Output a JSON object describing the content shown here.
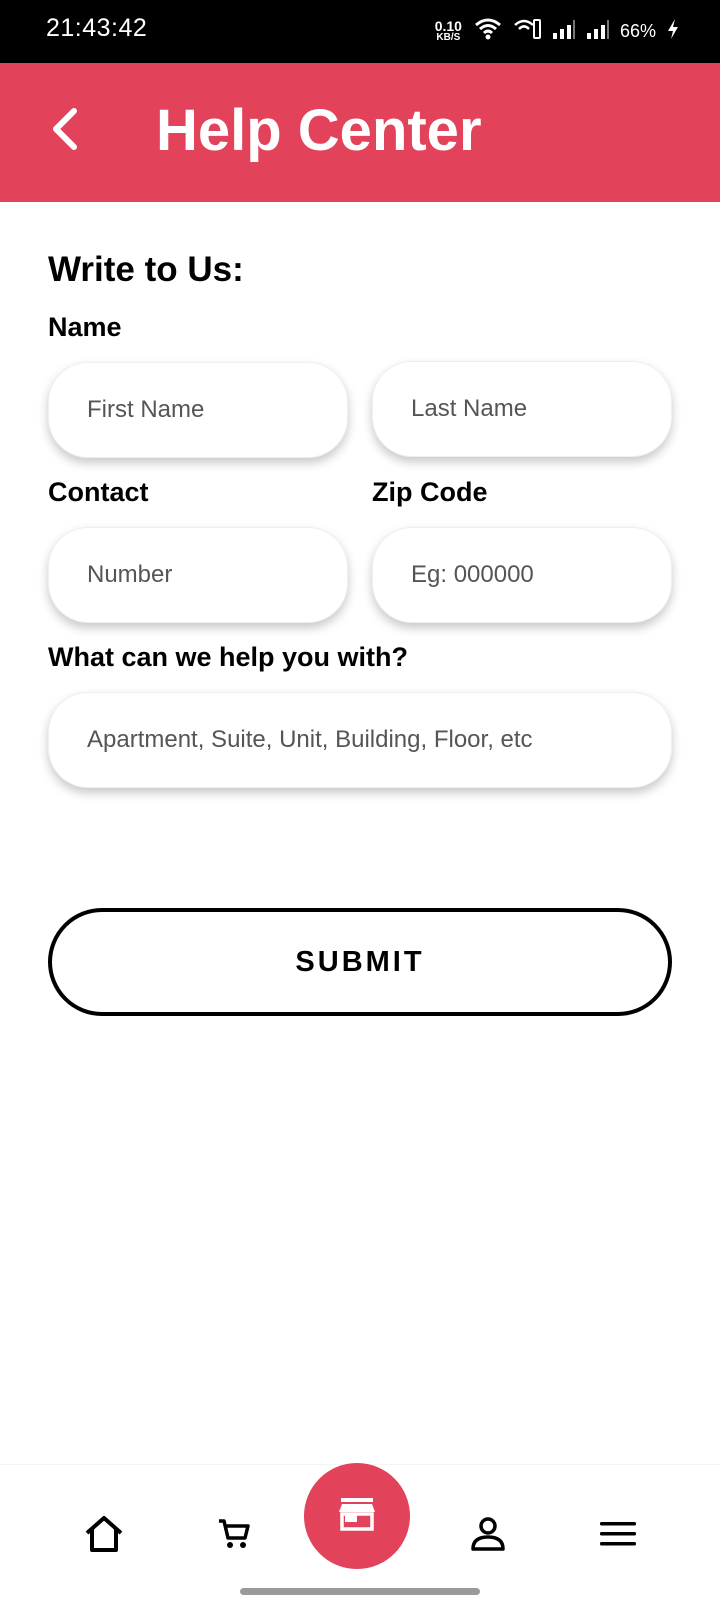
{
  "status_bar": {
    "time": "21:43:42",
    "net_speed_value": "0.10",
    "net_speed_unit": "KB/S",
    "battery": "66%"
  },
  "header": {
    "title": "Help Center",
    "back_icon": "chevron-left-icon"
  },
  "form": {
    "section_title": "Write to Us:",
    "name_label": "Name",
    "first_name_placeholder": "First Name",
    "last_name_placeholder": "Last Name",
    "contact_label": "Contact",
    "number_placeholder": "Number",
    "zip_label": "Zip Code",
    "zip_placeholder": "Eg: 000000",
    "help_label": "What can we help you with?",
    "help_placeholder": "Apartment, Suite, Unit, Building, Floor, etc",
    "submit_label": "SUBMIT"
  },
  "bottom_nav": {
    "items": [
      "home-icon",
      "cart-icon",
      "store-icon",
      "profile-icon",
      "menu-icon"
    ],
    "accent": "#e3425b"
  },
  "colors": {
    "header": "#e3425b",
    "status_bar": "#000000"
  }
}
